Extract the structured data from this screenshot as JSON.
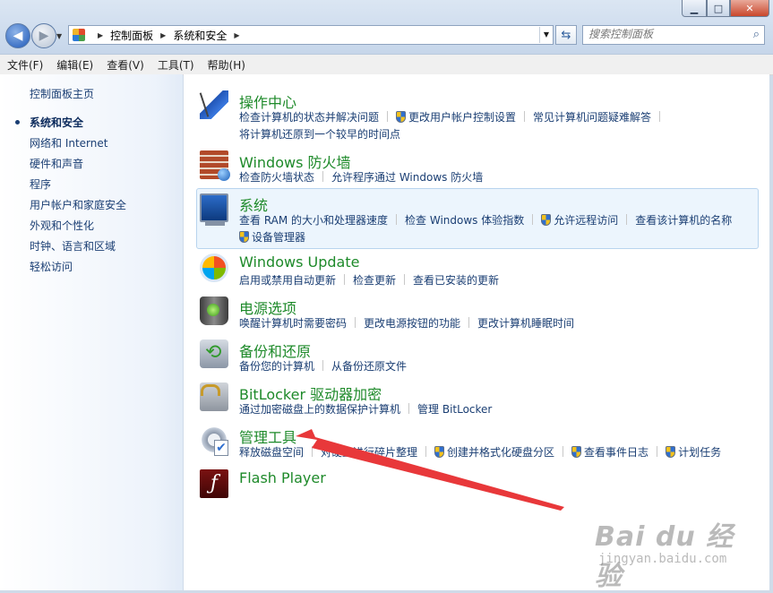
{
  "window": {
    "minimize_icon": "minimize-icon",
    "maximize_icon": "maximize-icon",
    "close_icon": "close-icon"
  },
  "nav": {
    "back_icon": "back-arrow-icon",
    "forward_icon": "forward-arrow-icon",
    "breadcrumb": [
      "控制面板",
      "系统和安全"
    ],
    "search_placeholder": "搜索控制面板"
  },
  "menu": [
    "文件(F)",
    "编辑(E)",
    "查看(V)",
    "工具(T)",
    "帮助(H)"
  ],
  "sidebar": {
    "home": "控制面板主页",
    "items": [
      {
        "label": "系统和安全",
        "active": true
      },
      {
        "label": "网络和 Internet",
        "active": false
      },
      {
        "label": "硬件和声音",
        "active": false
      },
      {
        "label": "程序",
        "active": false
      },
      {
        "label": "用户帐户和家庭安全",
        "active": false
      },
      {
        "label": "外观和个性化",
        "active": false
      },
      {
        "label": "时钟、语言和区域",
        "active": false
      },
      {
        "label": "轻松访问",
        "active": false
      }
    ]
  },
  "categories": [
    {
      "title": "操作中心",
      "icon": "flag-icon",
      "links": [
        {
          "text": "检查计算机的状态并解决问题",
          "shield": false
        },
        {
          "text": "更改用户帐户控制设置",
          "shield": true
        },
        {
          "text": "常见计算机问题疑难解答",
          "shield": false
        },
        {
          "text": "将计算机还原到一个较早的时间点",
          "shield": false
        }
      ]
    },
    {
      "title": "Windows 防火墙",
      "icon": "firewall-icon",
      "links": [
        {
          "text": "检查防火墙状态",
          "shield": false
        },
        {
          "text": "允许程序通过 Windows 防火墙",
          "shield": false
        }
      ]
    },
    {
      "title": "系统",
      "icon": "computer-icon",
      "links": [
        {
          "text": "查看 RAM 的大小和处理器速度",
          "shield": false
        },
        {
          "text": "检查 Windows 体验指数",
          "shield": false
        },
        {
          "text": "允许远程访问",
          "shield": true
        },
        {
          "text": "查看该计算机的名称",
          "shield": false
        },
        {
          "text": "设备管理器",
          "shield": true
        }
      ]
    },
    {
      "title": "Windows Update",
      "icon": "windows-update-icon",
      "links": [
        {
          "text": "启用或禁用自动更新",
          "shield": false
        },
        {
          "text": "检查更新",
          "shield": false
        },
        {
          "text": "查看已安装的更新",
          "shield": false
        }
      ]
    },
    {
      "title": "电源选项",
      "icon": "battery-icon",
      "links": [
        {
          "text": "唤醒计算机时需要密码",
          "shield": false
        },
        {
          "text": "更改电源按钮的功能",
          "shield": false
        },
        {
          "text": "更改计算机睡眠时间",
          "shield": false
        }
      ]
    },
    {
      "title": "备份和还原",
      "icon": "backup-icon",
      "links": [
        {
          "text": "备份您的计算机",
          "shield": false
        },
        {
          "text": "从备份还原文件",
          "shield": false
        }
      ]
    },
    {
      "title": "BitLocker 驱动器加密",
      "icon": "bitlocker-icon",
      "links": [
        {
          "text": "通过加密磁盘上的数据保护计算机",
          "shield": false
        },
        {
          "text": "管理 BitLocker",
          "shield": false
        }
      ]
    },
    {
      "title": "管理工具",
      "icon": "admin-tools-icon",
      "links": [
        {
          "text": "释放磁盘空间",
          "shield": false
        },
        {
          "text": "对硬盘进行碎片整理",
          "shield": false
        },
        {
          "text": "创建并格式化硬盘分区",
          "shield": true
        },
        {
          "text": "查看事件日志",
          "shield": true
        },
        {
          "text": "计划任务",
          "shield": true
        }
      ]
    },
    {
      "title": "Flash Player",
      "icon": "flash-player-icon",
      "links": []
    }
  ],
  "annotation": {
    "arrow_color": "#e8383a"
  },
  "watermark": {
    "main": "Bai du 经验",
    "sub": "jingyan.baidu.com"
  }
}
